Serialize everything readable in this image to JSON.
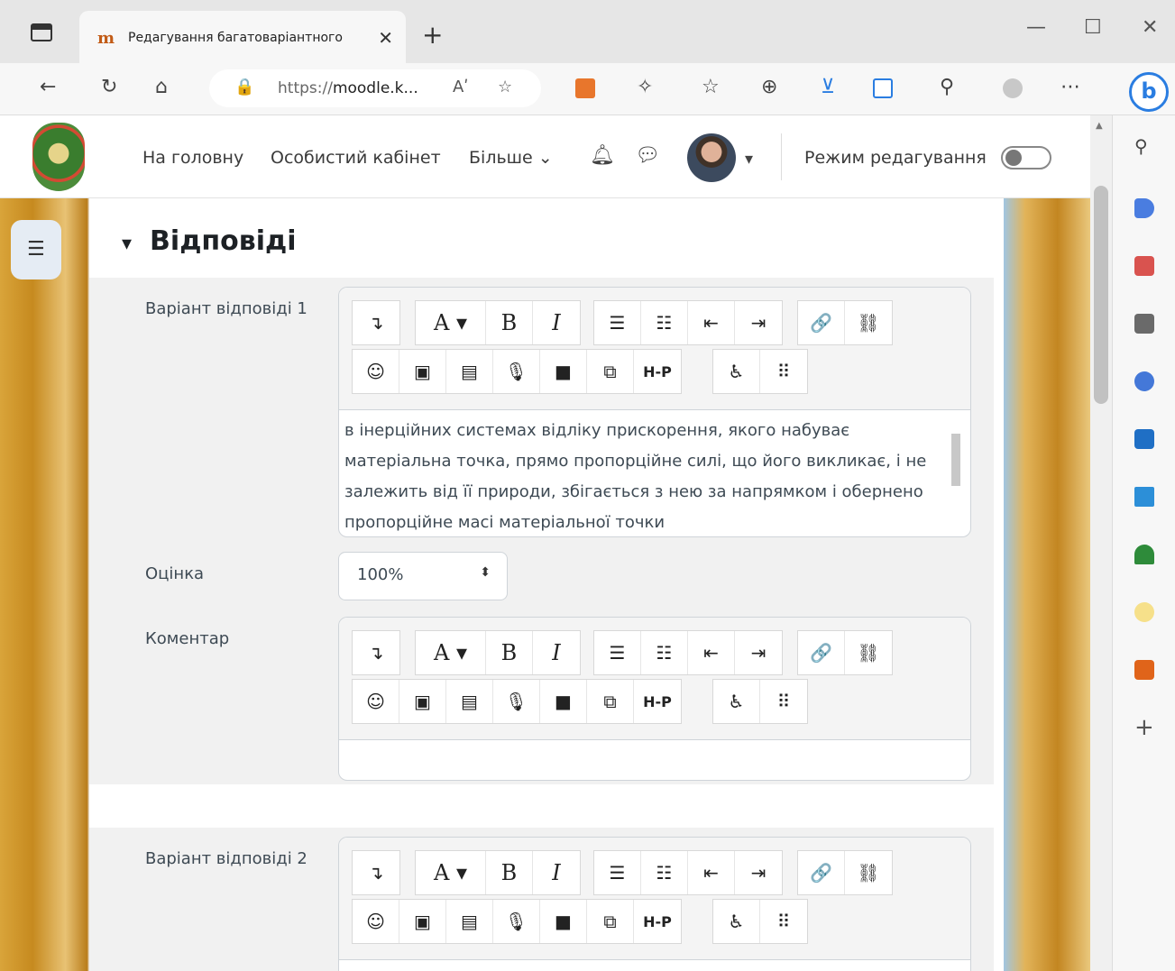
{
  "browser": {
    "tab_title": "Редагування багатоваріантного",
    "tab_favicon": "moodle-icon",
    "url_prefix": "https://",
    "url_host": "moodle.k...",
    "reader_label": "Aʹ",
    "new_tab": "+",
    "window_controls": [
      "—",
      "☐",
      "✕"
    ]
  },
  "navbar": {
    "links": [
      "На головну",
      "Особистий кабінет",
      "Більше"
    ],
    "more_chevron": "⌄",
    "edit_mode_label": "Режим редагування"
  },
  "section": {
    "title": "Відповіді",
    "answers": [
      {
        "label": "Варіант відповіді 1",
        "text": "в інерційних системах відліку прискорення, якого набуває матеріальна точка, прямо пропорційне силі, що його викликає, і не залежить від її природи, збігається з нею за напрямком і обернено пропорційне масі матеріальної точки",
        "grade_label": "Оцінка",
        "grade_value": "100%",
        "feedback_label": "Коментар"
      },
      {
        "label": "Варіант відповіді 2"
      }
    ]
  },
  "editor_toolbar": {
    "row1": [
      "↴",
      "A ▾",
      "B",
      "I",
      "☰",
      "☷",
      "⇤",
      "⇥",
      "🔗",
      "⛓"
    ],
    "row2": [
      "☺",
      "▣",
      "▤",
      "🎙",
      "■",
      "⧉",
      "H-P",
      "♿",
      "⠿"
    ]
  },
  "colors": {
    "accent": "#2a7de1",
    "fieldset_bg": "#f1f1f1",
    "text": "#3e4a54"
  }
}
